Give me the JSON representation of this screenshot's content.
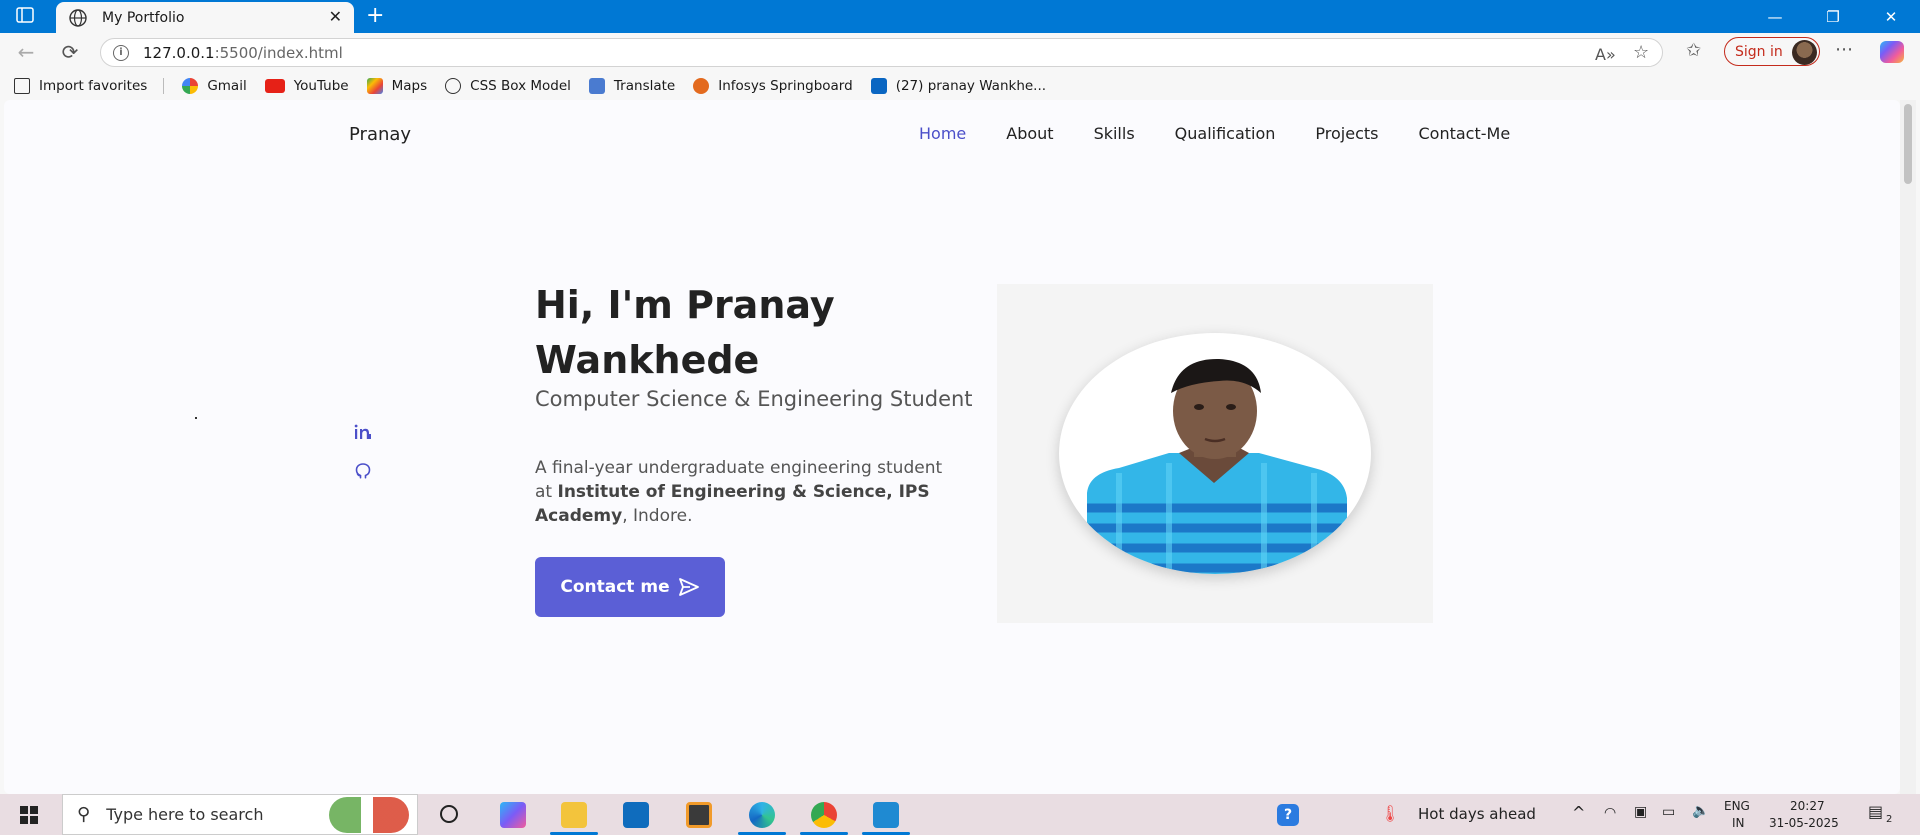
{
  "browser": {
    "tab_title": "My Portfolio",
    "url_host": "127.0.0.1",
    "url_rest": ":5500/index.html",
    "signin_label": "Sign in",
    "bookmarks": [
      "Import favorites",
      "Gmail",
      "YouTube",
      "Maps",
      "CSS Box Model",
      "Translate",
      "Infosys Springboard",
      "(27) pranay Wankhe..."
    ]
  },
  "site": {
    "logo": "Pranay",
    "menu": [
      "Home",
      "About",
      "Skills",
      "Qualification",
      "Projects",
      "Contact-Me"
    ],
    "active_menu": "Home",
    "hero": {
      "title": "Hi, I'm Pranay Wankhede",
      "subtitle": "Computer Science & Engineering Student",
      "desc_prefix": "A final-year undergraduate engineering student at ",
      "desc_bold": "Institute of Engineering & Science, IPS Academy",
      "desc_suffix": ", Indore.",
      "button_label": "Contact me"
    },
    "accent_color": "#5b5fd6"
  },
  "taskbar": {
    "search_placeholder": "Type here to search",
    "weather": "Hot days ahead",
    "lang_top": "ENG",
    "lang_bottom": "IN",
    "time": "20:27",
    "date": "31-05-2025",
    "notif_count": "2"
  }
}
